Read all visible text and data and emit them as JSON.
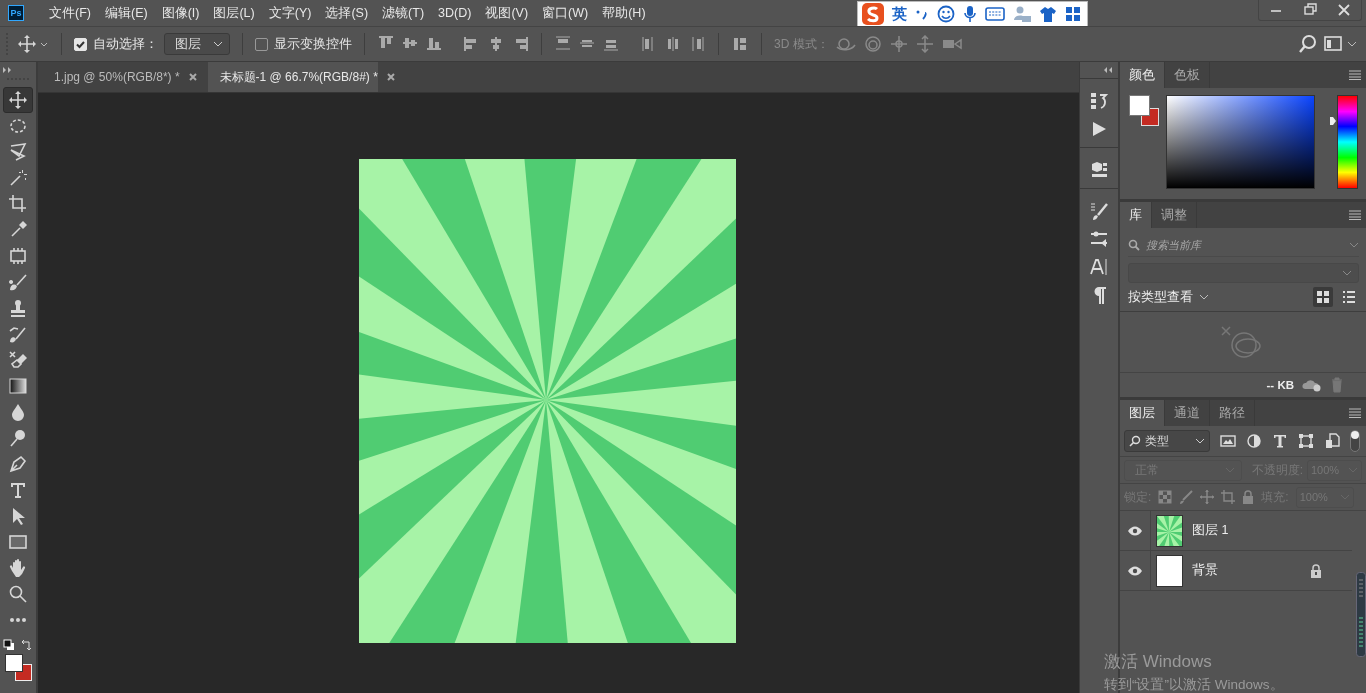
{
  "logo": "Ps",
  "menu": [
    "文件(F)",
    "编辑(E)",
    "图像(I)",
    "图层(L)",
    "文字(Y)",
    "选择(S)",
    "滤镜(T)",
    "3D(D)",
    "视图(V)",
    "窗口(W)",
    "帮助(H)"
  ],
  "ime_toolbar": {
    "mode": "英"
  },
  "options_bar": {
    "auto_select": {
      "label": "自动选择：",
      "checked": true
    },
    "target": {
      "value": "图层"
    },
    "transform_controls": {
      "label": "显示变换控件",
      "checked": false
    },
    "mode_3d_label": "3D 模式："
  },
  "toolbox": {
    "tools": [
      {
        "selected": true
      },
      {
        "selected": false
      },
      {
        "selected": false
      },
      {
        "selected": false
      },
      {
        "selected": false
      },
      {
        "selected": false
      },
      {
        "selected": false
      },
      {
        "selected": false
      },
      {
        "selected": false
      },
      {
        "selected": false
      },
      {
        "selected": false
      },
      {
        "selected": false
      },
      {
        "selected": false
      },
      {
        "selected": false
      },
      {
        "selected": false
      },
      {
        "selected": false
      },
      {
        "selected": false
      },
      {
        "selected": false
      },
      {
        "selected": false
      },
      {
        "selected": false
      },
      {
        "selected": false
      }
    ]
  },
  "tabs": [
    {
      "label": "1.jpg @ 50%(RGB/8*) *",
      "selected": false
    },
    {
      "label": "未标题-1 @ 66.7%(RGB/8#) *",
      "selected": true
    }
  ],
  "color_panel": {
    "tabs": [
      {
        "label": "颜色",
        "selected": true
      },
      {
        "label": "色板",
        "selected": false
      }
    ]
  },
  "library_panel": {
    "tabs": [
      {
        "label": "库",
        "selected": true
      },
      {
        "label": "调整",
        "selected": false
      }
    ],
    "search": {
      "placeholder": "搜索当前库"
    },
    "view_by": "按类型查看",
    "grid_view": true,
    "storage": "-- KB"
  },
  "layers_panel": {
    "tabs": [
      {
        "label": "图层",
        "selected": true
      },
      {
        "label": "通道",
        "selected": false
      },
      {
        "label": "路径",
        "selected": false
      }
    ],
    "filter": "类型",
    "blend_mode": {
      "value": "正常",
      "disabled": true
    },
    "opacity": {
      "label": "不透明度:",
      "value": "100%",
      "disabled": true
    },
    "lock_label": "锁定:",
    "fill": {
      "label": "填充:",
      "value": "100%",
      "disabled": true
    },
    "layers": [
      {
        "name": "图层 1",
        "visible": true,
        "locked": false,
        "kind": "starburst"
      },
      {
        "name": "背景",
        "visible": true,
        "locked": true,
        "kind": "white"
      }
    ]
  },
  "activation_notice": {
    "title": "激活 Windows",
    "text": "转到“设置”以激活 Windows。"
  }
}
